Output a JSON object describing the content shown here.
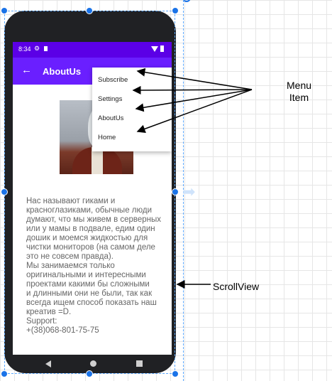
{
  "phone": {
    "status_time": "8:34",
    "appbar_title": "AboutUs",
    "menu_items": [
      "Subscribe",
      "Settings",
      "AboutUs",
      "Home"
    ],
    "body_text": "Нас называют гиками и\nкрасноглазиками, обычные люди\nдумают, что мы живем в серверных\nили у мамы в подвале, едим один\nдошик и моемся жидкостью для\nчистки мониторов (на самом деле\nэто не совсем правда).\nМы занимаемся только\nоригинальными и интересными\nпроектами какими бы сложными\nи длинными они не были, так как\nвсегда ищем способ показать наш\nкреатив =D.\nSupport:\n+(38)068-801-75-75"
  },
  "annotations": {
    "menu_item_label": "Menu\nItem",
    "scrollview_label": "ScrollView"
  },
  "colors": {
    "status_bar": "#5b00e6",
    "app_bar": "#6a1fff",
    "selection": "#1a73e8"
  },
  "icons": [
    "settings-gear-icon",
    "sim-card-icon",
    "wifi-icon",
    "battery-icon",
    "back-arrow-icon",
    "nav-back-icon",
    "nav-home-icon",
    "nav-recents-icon"
  ]
}
